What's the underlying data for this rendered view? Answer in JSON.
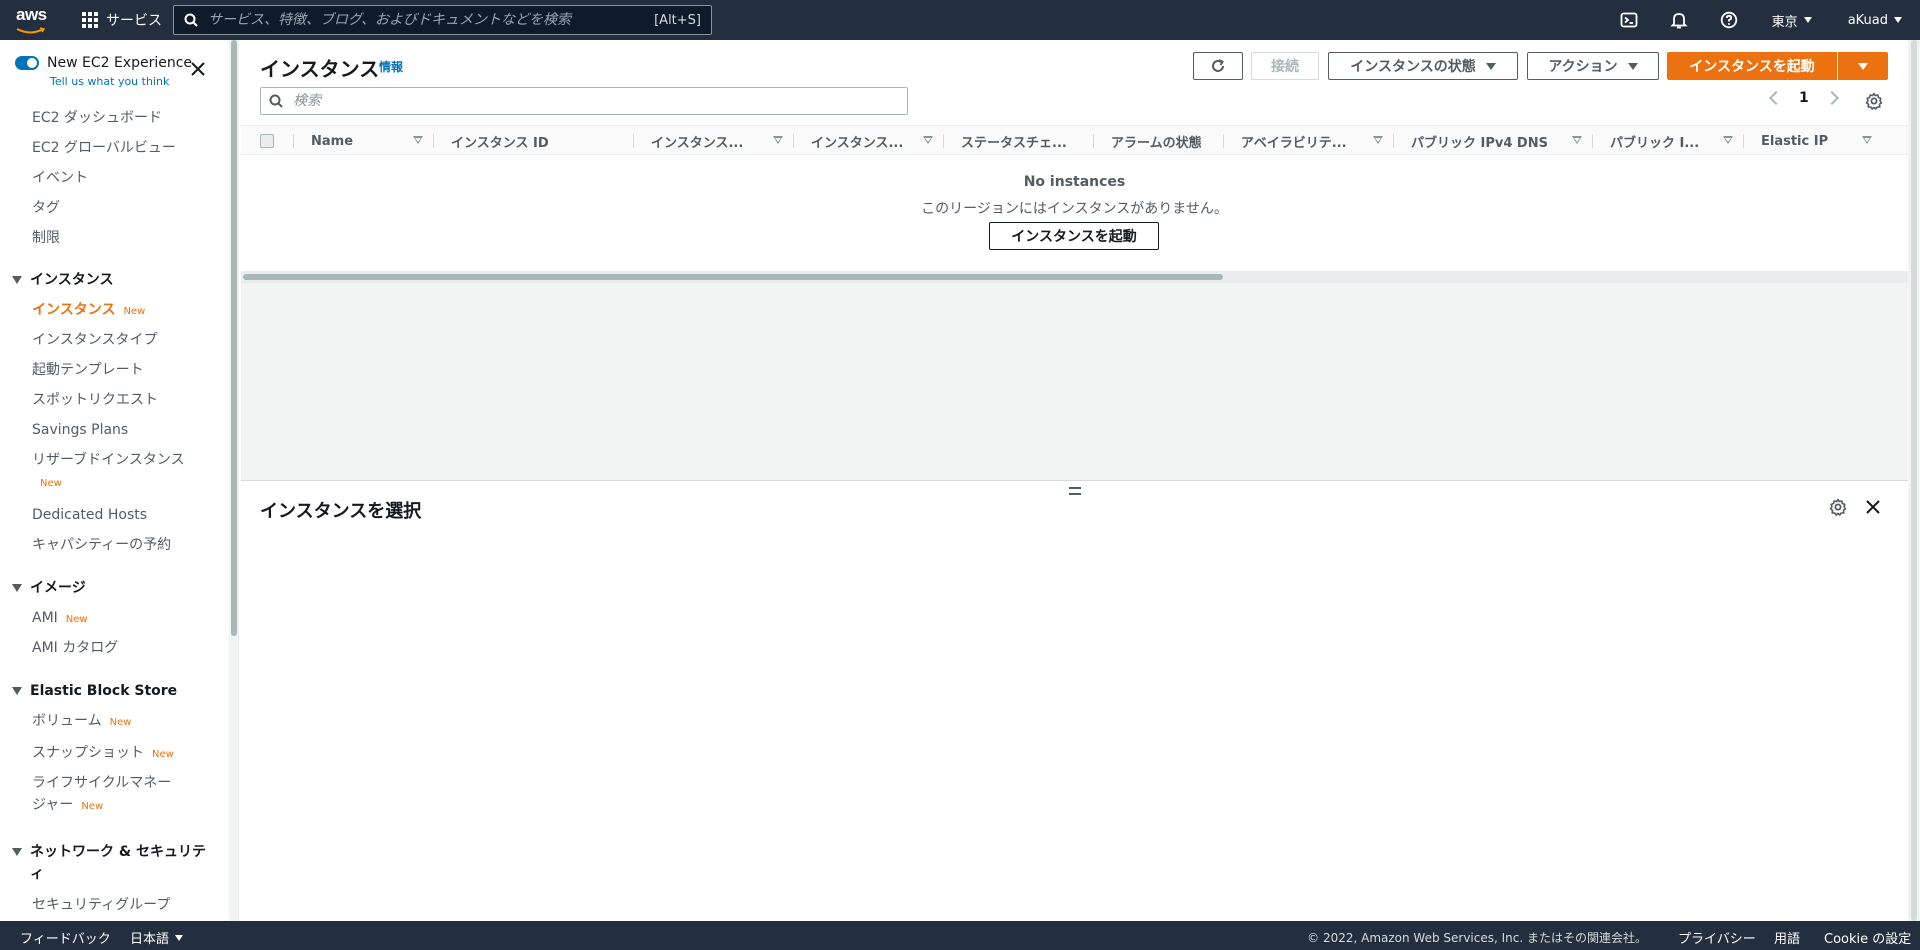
{
  "topnav": {
    "logo_text": "aws",
    "services_label": "サービス",
    "search_placeholder": "サービス、特徴、ブログ、およびドキュメントなどを検索",
    "search_hint": "[Alt+S]",
    "region": "東京",
    "account": "aKuad"
  },
  "sidebar": {
    "toggle_label": "New EC2 Experience",
    "tell_link": "Tell us what you think",
    "items_top": [
      "EC2 ダッシュボード",
      "EC2 グローバルビュー",
      "イベント",
      "タグ",
      "制限"
    ],
    "sections": {
      "instances": "インスタンス",
      "images": "イメージ",
      "ebs": "Elastic Block Store",
      "network": "ネットワーク & セキュリティ"
    },
    "instances_items": [
      "インスタンス",
      "インスタンスタイプ",
      "起動テンプレート",
      "スポットリクエスト",
      "Savings Plans",
      "リザーブドインスタンス",
      "Dedicated Hosts",
      "キャパシティーの予約"
    ],
    "images_items": [
      "AMI",
      "AMI カタログ"
    ],
    "ebs_items": [
      "ボリューム",
      "スナップショット",
      "ライフサイクルマネー",
      "ジャー"
    ],
    "network_items": [
      "セキュリティグループ"
    ],
    "new_badge": "New"
  },
  "main": {
    "title": "インスタンス",
    "info": "情報",
    "buttons": {
      "connect": "接続",
      "instance_state": "インスタンスの状態",
      "actions": "アクション",
      "launch": "インスタンスを起動"
    },
    "filter_placeholder": "検索",
    "page_number": "1",
    "columns": [
      "Name",
      "インスタンス ID",
      "インスタンス...",
      "インスタンス...",
      "ステータスチェ...",
      "アラームの状態",
      "アベイラビリテ...",
      "パブリック IPv4 DNS",
      "パブリック I...",
      "Elastic IP"
    ],
    "empty_title": "No instances",
    "empty_desc": "このリージョンにはインスタンスがありません。",
    "empty_button": "インスタンスを起動",
    "detail_title": "インスタンスを選択"
  },
  "footer": {
    "feedback": "フィードバック",
    "language": "日本語",
    "copyright": "© 2022, Amazon Web Services, Inc. またはその関連会社。",
    "privacy": "プライバシー",
    "terms": "用語",
    "cookie": "Cookie の設定"
  },
  "colors": {
    "nav_bg": "#232f3e",
    "accent_orange": "#ec7211",
    "link_blue": "#0073bb"
  }
}
